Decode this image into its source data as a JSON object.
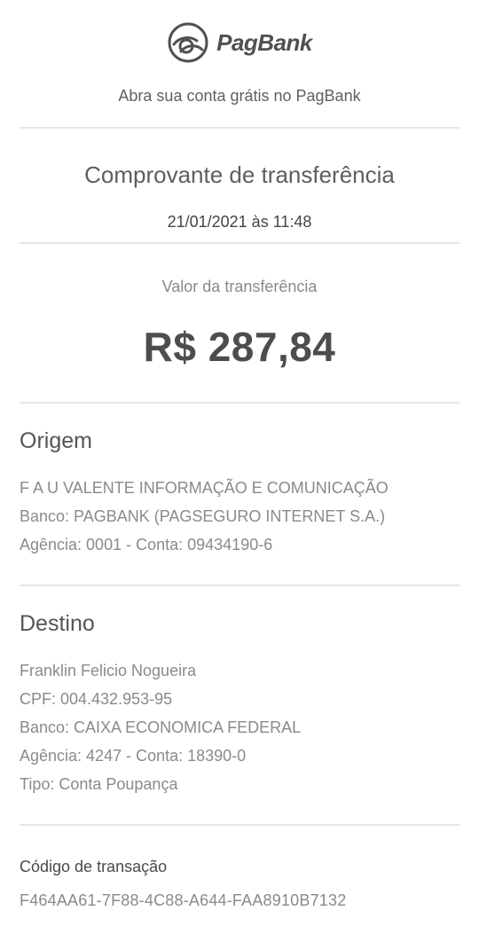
{
  "header": {
    "brand_name": "PagBank",
    "logo_icon": "pagbank-logo-icon",
    "promo_text": "Abra sua conta grátis no PagBank"
  },
  "receipt": {
    "title": "Comprovante de transferência",
    "datetime": "21/01/2021 às 11:48",
    "amount_label": "Valor da transferência",
    "amount": "R$ 287,84"
  },
  "origin": {
    "title": "Origem",
    "name": "F A U VALENTE INFORMAÇÃO E COMUNICAÇÃO",
    "bank": "Banco: PAGBANK (PAGSEGURO INTERNET S.A.)",
    "account": "Agência: 0001 - Conta: 09434190-6"
  },
  "destination": {
    "title": "Destino",
    "name": "Franklin Felicio Nogueira",
    "cpf": "CPF: 004.432.953-95",
    "bank": "Banco: CAIXA ECONOMICA FEDERAL",
    "account": "Agência: 4247 - Conta: 18390-0",
    "type": "Tipo: Conta Poupança"
  },
  "transaction": {
    "label": "Código de transação",
    "code": "F464AA61-7F88-4C88-A644-FAA8910B7132"
  },
  "colors": {
    "text_dark": "#555555",
    "text_muted": "#8a8a8a",
    "divider": "#e6e6e6",
    "background": "#ffffff"
  }
}
